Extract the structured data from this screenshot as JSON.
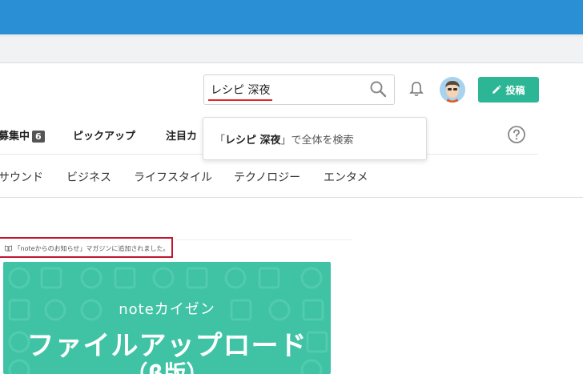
{
  "header": {
    "search_value": "レシピ 深夜",
    "post_label": "投稿"
  },
  "nav": {
    "items": [
      {
        "label": "募集中",
        "badge": "6"
      },
      {
        "label": "ピックアップ"
      },
      {
        "label": "注目カ"
      }
    ]
  },
  "search_dropdown": {
    "quote_open": "「",
    "query": "レシピ 深夜",
    "suffix": "」で全体を検索"
  },
  "categories": [
    "サウンド",
    "ビジネス",
    "ライフスタイル",
    "テクノロジー",
    "エンタメ"
  ],
  "notice": {
    "text": "「noteからのお知らせ」マガジンに追加されました。"
  },
  "thumbnail": {
    "subtitle": "noteカイゼン",
    "title": "ファイルアップロード",
    "title_line2": "（β版）"
  },
  "colors": {
    "top_bar": "#2b8fd5",
    "accent_green": "#2cb696",
    "thumb_bg": "#3fc3a4",
    "notice_border": "#c0162d",
    "search_underline": "#e0262b"
  }
}
